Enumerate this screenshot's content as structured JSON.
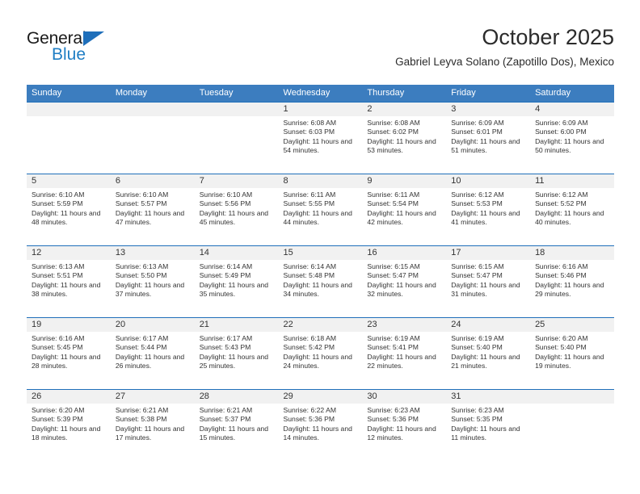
{
  "brand": {
    "name_part1": "General",
    "name_part2": "Blue",
    "color_dark": "#1a1a1a",
    "color_blue": "#1f7ec4"
  },
  "header": {
    "title": "October 2025",
    "subtitle": "Gabriel Leyva Solano (Zapotillo Dos), Mexico"
  },
  "theme": {
    "header_blue": "#3c7dbf",
    "row_rule_blue": "#1f6fba",
    "daynum_band": "#f1f1f1",
    "text": "#333333"
  },
  "weekdays": [
    "Sunday",
    "Monday",
    "Tuesday",
    "Wednesday",
    "Thursday",
    "Friday",
    "Saturday"
  ],
  "weeks": [
    [
      {
        "day": "",
        "sunrise": "",
        "sunset": "",
        "daylight": "",
        "empty": true
      },
      {
        "day": "",
        "sunrise": "",
        "sunset": "",
        "daylight": "",
        "empty": true
      },
      {
        "day": "",
        "sunrise": "",
        "sunset": "",
        "daylight": "",
        "empty": true
      },
      {
        "day": "1",
        "sunrise": "Sunrise: 6:08 AM",
        "sunset": "Sunset: 6:03 PM",
        "daylight": "Daylight: 11 hours and 54 minutes."
      },
      {
        "day": "2",
        "sunrise": "Sunrise: 6:08 AM",
        "sunset": "Sunset: 6:02 PM",
        "daylight": "Daylight: 11 hours and 53 minutes."
      },
      {
        "day": "3",
        "sunrise": "Sunrise: 6:09 AM",
        "sunset": "Sunset: 6:01 PM",
        "daylight": "Daylight: 11 hours and 51 minutes."
      },
      {
        "day": "4",
        "sunrise": "Sunrise: 6:09 AM",
        "sunset": "Sunset: 6:00 PM",
        "daylight": "Daylight: 11 hours and 50 minutes."
      }
    ],
    [
      {
        "day": "5",
        "sunrise": "Sunrise: 6:10 AM",
        "sunset": "Sunset: 5:59 PM",
        "daylight": "Daylight: 11 hours and 48 minutes."
      },
      {
        "day": "6",
        "sunrise": "Sunrise: 6:10 AM",
        "sunset": "Sunset: 5:57 PM",
        "daylight": "Daylight: 11 hours and 47 minutes."
      },
      {
        "day": "7",
        "sunrise": "Sunrise: 6:10 AM",
        "sunset": "Sunset: 5:56 PM",
        "daylight": "Daylight: 11 hours and 45 minutes."
      },
      {
        "day": "8",
        "sunrise": "Sunrise: 6:11 AM",
        "sunset": "Sunset: 5:55 PM",
        "daylight": "Daylight: 11 hours and 44 minutes."
      },
      {
        "day": "9",
        "sunrise": "Sunrise: 6:11 AM",
        "sunset": "Sunset: 5:54 PM",
        "daylight": "Daylight: 11 hours and 42 minutes."
      },
      {
        "day": "10",
        "sunrise": "Sunrise: 6:12 AM",
        "sunset": "Sunset: 5:53 PM",
        "daylight": "Daylight: 11 hours and 41 minutes."
      },
      {
        "day": "11",
        "sunrise": "Sunrise: 6:12 AM",
        "sunset": "Sunset: 5:52 PM",
        "daylight": "Daylight: 11 hours and 40 minutes."
      }
    ],
    [
      {
        "day": "12",
        "sunrise": "Sunrise: 6:13 AM",
        "sunset": "Sunset: 5:51 PM",
        "daylight": "Daylight: 11 hours and 38 minutes."
      },
      {
        "day": "13",
        "sunrise": "Sunrise: 6:13 AM",
        "sunset": "Sunset: 5:50 PM",
        "daylight": "Daylight: 11 hours and 37 minutes."
      },
      {
        "day": "14",
        "sunrise": "Sunrise: 6:14 AM",
        "sunset": "Sunset: 5:49 PM",
        "daylight": "Daylight: 11 hours and 35 minutes."
      },
      {
        "day": "15",
        "sunrise": "Sunrise: 6:14 AM",
        "sunset": "Sunset: 5:48 PM",
        "daylight": "Daylight: 11 hours and 34 minutes."
      },
      {
        "day": "16",
        "sunrise": "Sunrise: 6:15 AM",
        "sunset": "Sunset: 5:47 PM",
        "daylight": "Daylight: 11 hours and 32 minutes."
      },
      {
        "day": "17",
        "sunrise": "Sunrise: 6:15 AM",
        "sunset": "Sunset: 5:47 PM",
        "daylight": "Daylight: 11 hours and 31 minutes."
      },
      {
        "day": "18",
        "sunrise": "Sunrise: 6:16 AM",
        "sunset": "Sunset: 5:46 PM",
        "daylight": "Daylight: 11 hours and 29 minutes."
      }
    ],
    [
      {
        "day": "19",
        "sunrise": "Sunrise: 6:16 AM",
        "sunset": "Sunset: 5:45 PM",
        "daylight": "Daylight: 11 hours and 28 minutes."
      },
      {
        "day": "20",
        "sunrise": "Sunrise: 6:17 AM",
        "sunset": "Sunset: 5:44 PM",
        "daylight": "Daylight: 11 hours and 26 minutes."
      },
      {
        "day": "21",
        "sunrise": "Sunrise: 6:17 AM",
        "sunset": "Sunset: 5:43 PM",
        "daylight": "Daylight: 11 hours and 25 minutes."
      },
      {
        "day": "22",
        "sunrise": "Sunrise: 6:18 AM",
        "sunset": "Sunset: 5:42 PM",
        "daylight": "Daylight: 11 hours and 24 minutes."
      },
      {
        "day": "23",
        "sunrise": "Sunrise: 6:19 AM",
        "sunset": "Sunset: 5:41 PM",
        "daylight": "Daylight: 11 hours and 22 minutes."
      },
      {
        "day": "24",
        "sunrise": "Sunrise: 6:19 AM",
        "sunset": "Sunset: 5:40 PM",
        "daylight": "Daylight: 11 hours and 21 minutes."
      },
      {
        "day": "25",
        "sunrise": "Sunrise: 6:20 AM",
        "sunset": "Sunset: 5:40 PM",
        "daylight": "Daylight: 11 hours and 19 minutes."
      }
    ],
    [
      {
        "day": "26",
        "sunrise": "Sunrise: 6:20 AM",
        "sunset": "Sunset: 5:39 PM",
        "daylight": "Daylight: 11 hours and 18 minutes."
      },
      {
        "day": "27",
        "sunrise": "Sunrise: 6:21 AM",
        "sunset": "Sunset: 5:38 PM",
        "daylight": "Daylight: 11 hours and 17 minutes."
      },
      {
        "day": "28",
        "sunrise": "Sunrise: 6:21 AM",
        "sunset": "Sunset: 5:37 PM",
        "daylight": "Daylight: 11 hours and 15 minutes."
      },
      {
        "day": "29",
        "sunrise": "Sunrise: 6:22 AM",
        "sunset": "Sunset: 5:36 PM",
        "daylight": "Daylight: 11 hours and 14 minutes."
      },
      {
        "day": "30",
        "sunrise": "Sunrise: 6:23 AM",
        "sunset": "Sunset: 5:36 PM",
        "daylight": "Daylight: 11 hours and 12 minutes."
      },
      {
        "day": "31",
        "sunrise": "Sunrise: 6:23 AM",
        "sunset": "Sunset: 5:35 PM",
        "daylight": "Daylight: 11 hours and 11 minutes."
      },
      {
        "day": "",
        "sunrise": "",
        "sunset": "",
        "daylight": "",
        "empty": true
      }
    ]
  ]
}
